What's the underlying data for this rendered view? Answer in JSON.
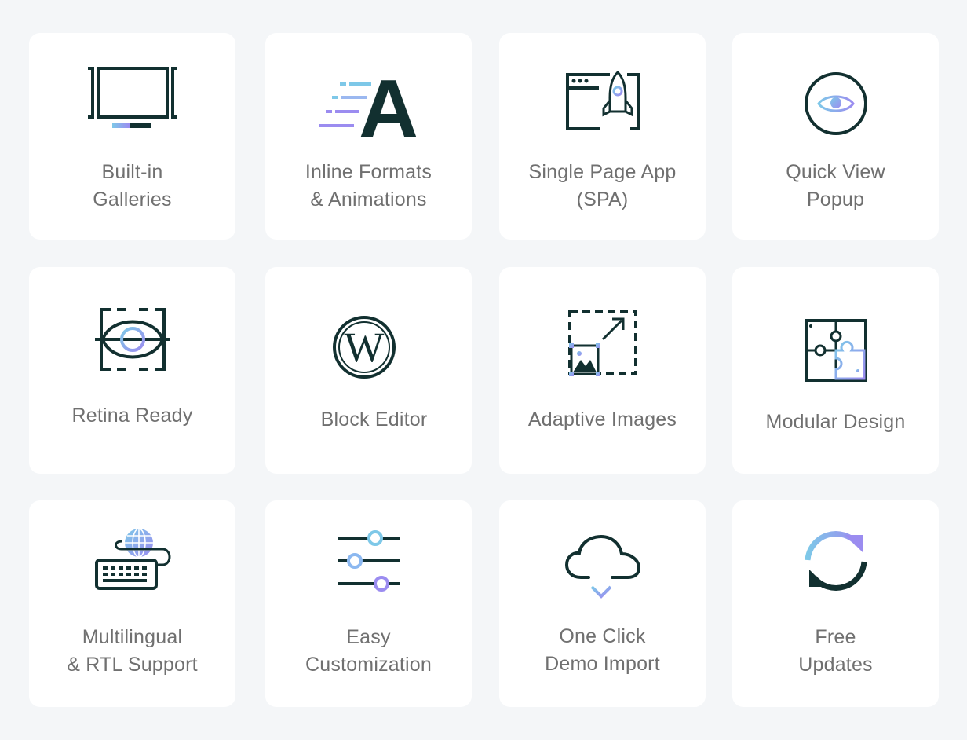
{
  "colors": {
    "background": "#f4f6f8",
    "card": "#ffffff",
    "icon_dark": "#123030",
    "accent_blue": "#7ec8e8",
    "accent_purple": "#9b8cf0",
    "text": "#707070"
  },
  "features": [
    {
      "icon": "monitor-icon",
      "lines": [
        "Built-in",
        "Galleries"
      ]
    },
    {
      "icon": "text-animation-icon",
      "lines": [
        "Inline Formats",
        "& Animations"
      ]
    },
    {
      "icon": "rocket-browser-icon",
      "lines": [
        "Single Page App",
        "(SPA)"
      ]
    },
    {
      "icon": "eye-icon",
      "lines": [
        "Quick View",
        "Popup"
      ]
    },
    {
      "icon": "retina-eye-icon",
      "lines": [
        "Retina Ready"
      ]
    },
    {
      "icon": "wordpress-icon",
      "lines": [
        "Block Editor"
      ]
    },
    {
      "icon": "resize-image-icon",
      "lines": [
        "Adaptive Images"
      ]
    },
    {
      "icon": "puzzle-icon",
      "lines": [
        "Modular Design"
      ]
    },
    {
      "icon": "keyboard-globe-icon",
      "lines": [
        "Multilingual",
        "& RTL Support"
      ]
    },
    {
      "icon": "sliders-icon",
      "lines": [
        "Easy",
        "Customization"
      ]
    },
    {
      "icon": "cloud-download-icon",
      "lines": [
        "One Click",
        "Demo Import"
      ]
    },
    {
      "icon": "refresh-icon",
      "lines": [
        "Free",
        "Updates"
      ]
    }
  ]
}
